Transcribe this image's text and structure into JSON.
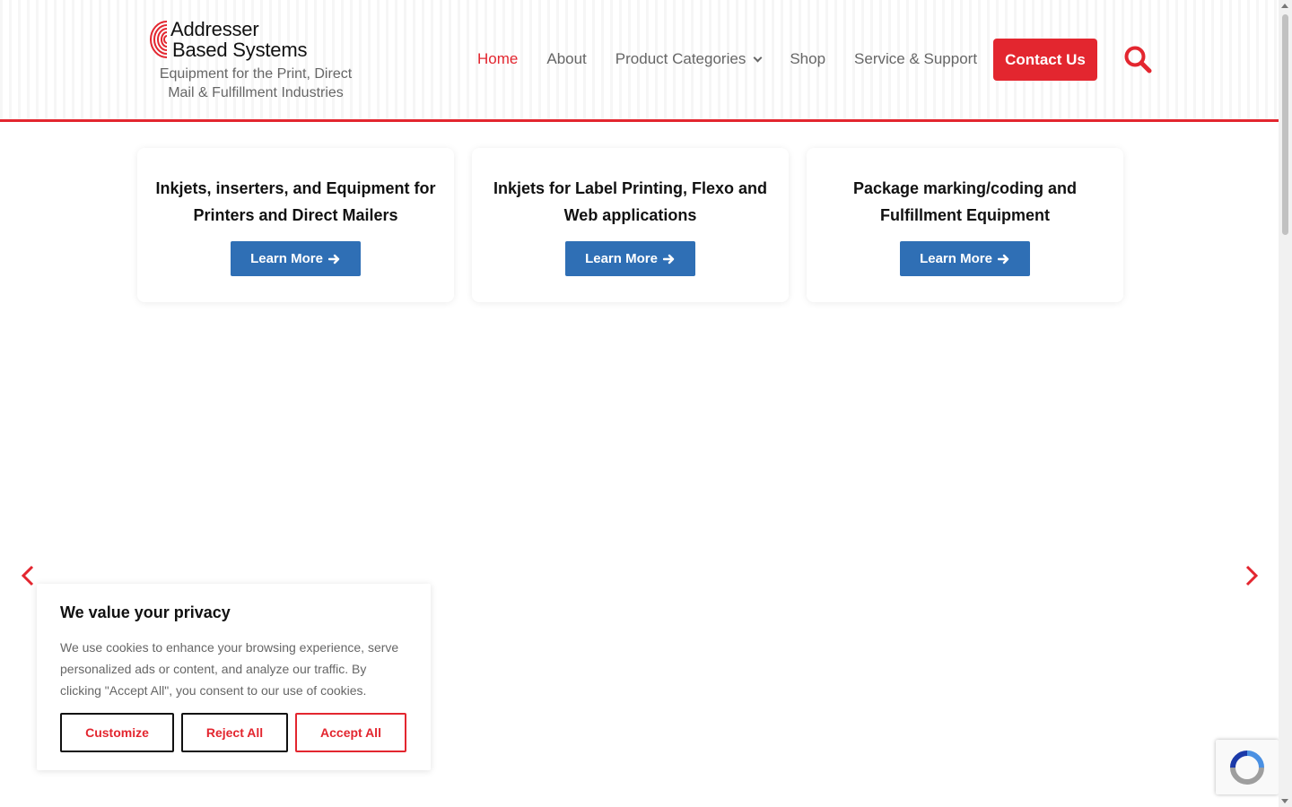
{
  "brand": {
    "name_line1": "Addresser",
    "name_line2": "Based Systems",
    "tagline": "Equipment for the Print, Direct Mail & Fulfillment Industries",
    "accent_color": "#e3262f"
  },
  "nav": {
    "items": [
      {
        "label": "Home",
        "active": true
      },
      {
        "label": "About"
      },
      {
        "label": "Product Categories",
        "has_dropdown": true
      },
      {
        "label": "Shop"
      },
      {
        "label": "Service & Support"
      }
    ],
    "contact_label": "Contact Us",
    "search_icon": "search-icon"
  },
  "cards": [
    {
      "title": "Inkjets, inserters, and Equipment for Printers and Direct Mailers",
      "button": "Learn More"
    },
    {
      "title": "Inkjets for Label Printing, Flexo and Web applications",
      "button": "Learn More"
    },
    {
      "title": "Package marking/coding and Fulfillment Equipment",
      "button": "Learn More"
    }
  ],
  "button_color": "#2f6fb5",
  "carousel": {
    "prev_icon": "chevron-left-icon",
    "next_icon": "chevron-right-icon"
  },
  "cookie": {
    "title": "We value your privacy",
    "text": "We use cookies to enhance your browsing experience, serve personalized ads or content, and analyze our traffic. By clicking \"Accept All\", you consent to our use of cookies.",
    "customize": "Customize",
    "reject": "Reject All",
    "accept": "Accept All"
  }
}
